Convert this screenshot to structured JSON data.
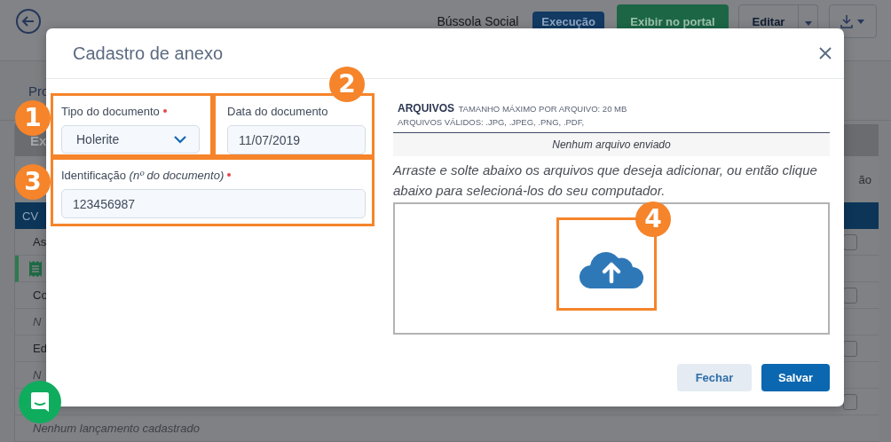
{
  "header": {
    "organization": "Bússola Social",
    "status_badge": "Execução",
    "portal_button": "Exibir no portal",
    "edit_button": "Editar"
  },
  "tab_fragment": "Pro",
  "table": {
    "section_fragment": "Ex",
    "column_1": "CV",
    "column_2": "ão",
    "rows": [
      {
        "kind": "text",
        "text": "As"
      },
      {
        "kind": "icon"
      },
      {
        "kind": "text",
        "text": "Co"
      },
      {
        "kind": "empty",
        "text": "N"
      },
      {
        "kind": "text",
        "text": "Ed"
      },
      {
        "kind": "empty",
        "text": "N"
      },
      {
        "kind": "blank"
      },
      {
        "kind": "empty",
        "text": "Nenhum lançamento cadastrado"
      }
    ]
  },
  "modal": {
    "title": "Cadastro de anexo",
    "document_type": {
      "label": "Tipo do documento",
      "required": true,
      "value": "Holerite"
    },
    "document_date": {
      "label": "Data do documento",
      "value": "11/07/2019"
    },
    "identification": {
      "label": "Identificação *(nº do documento)*",
      "required": true,
      "value": "123456987"
    },
    "files": {
      "heading": "ARQUIVOS",
      "max_size": "TAMANHO MÁXIMO POR ARQUIVO: 20 MB",
      "valid_types": "ARQUIVOS VÁLIDOS: .JPG, .JPEG, .PNG, .PDF,",
      "empty": "Nenhum arquivo enviado",
      "instructions": "Arraste e solte abaixo os arquivos que deseja adicionar, ou então clique abaixo para selecioná-los do seu computador."
    },
    "buttons": [
      {
        "label": "Fechar",
        "kind": "secondary"
      },
      {
        "label": "Salvar",
        "kind": "primary"
      }
    ]
  },
  "callouts": [
    {
      "number": "1"
    },
    {
      "number": "2"
    },
    {
      "number": "3"
    },
    {
      "number": "4"
    }
  ]
}
